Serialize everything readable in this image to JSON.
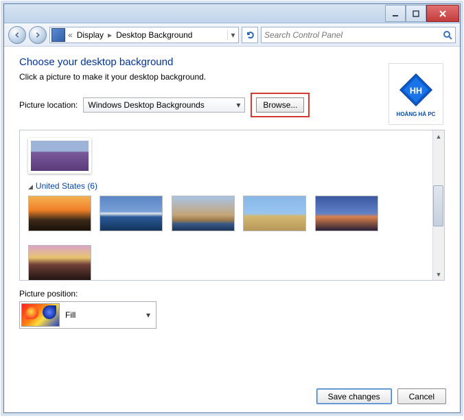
{
  "breadcrumb": {
    "prefix": "«",
    "l1": "Display",
    "l2": "Desktop Background"
  },
  "search": {
    "placeholder": "Search Control Panel"
  },
  "heading": "Choose your desktop background",
  "subtext": "Click a picture to make it your desktop background.",
  "location": {
    "label": "Picture location:",
    "value": "Windows Desktop Backgrounds",
    "browse": "Browse..."
  },
  "group": {
    "name": "United States",
    "count": "(6)"
  },
  "position": {
    "label": "Picture position:",
    "value": "Fill"
  },
  "buttons": {
    "save": "Save changes",
    "cancel": "Cancel"
  },
  "logo": {
    "text": "HOÀNG HÀ PC"
  }
}
